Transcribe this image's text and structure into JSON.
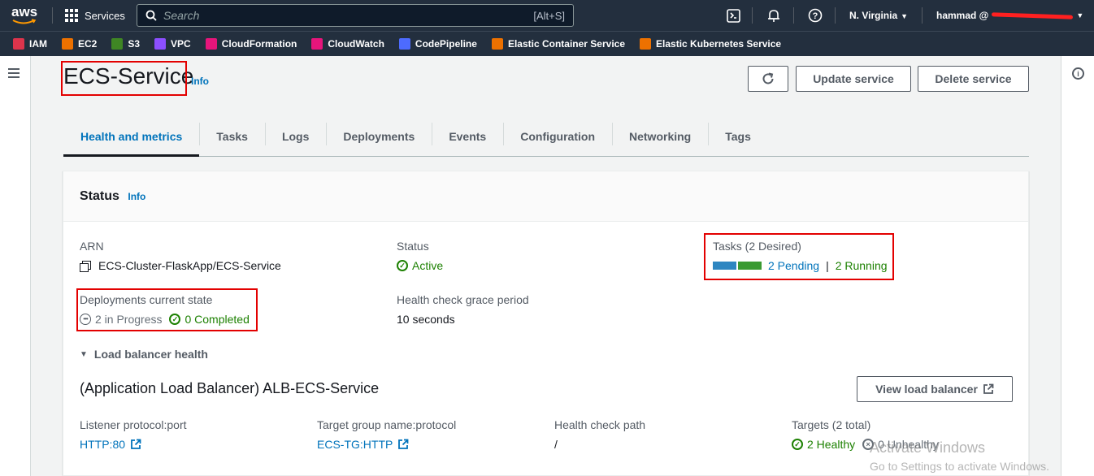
{
  "topnav": {
    "logo": "aws",
    "services_label": "Services",
    "search_placeholder": "Search",
    "search_shortcut": "[Alt+S]",
    "region": "N. Virginia",
    "user": "hammad @"
  },
  "favorites": [
    {
      "label": "IAM",
      "color": "#dd344c",
      "icon": "iam-icon"
    },
    {
      "label": "EC2",
      "color": "#ed7100",
      "icon": "ec2-icon"
    },
    {
      "label": "S3",
      "color": "#3f8624",
      "icon": "s3-icon"
    },
    {
      "label": "VPC",
      "color": "#8c4fff",
      "icon": "vpc-icon"
    },
    {
      "label": "CloudFormation",
      "color": "#e7157b",
      "icon": "cloudformation-icon"
    },
    {
      "label": "CloudWatch",
      "color": "#e7157b",
      "icon": "cloudwatch-icon"
    },
    {
      "label": "CodePipeline",
      "color": "#4d6bfe",
      "icon": "codepipeline-icon"
    },
    {
      "label": "Elastic Container Service",
      "color": "#ed7100",
      "icon": "ecs-icon"
    },
    {
      "label": "Elastic Kubernetes Service",
      "color": "#ed7100",
      "icon": "eks-icon"
    }
  ],
  "header": {
    "title": "ECS-Service",
    "info": "Info",
    "update_button": "Update service",
    "delete_button": "Delete service"
  },
  "tabs": [
    {
      "label": "Health and metrics",
      "active": true
    },
    {
      "label": "Tasks"
    },
    {
      "label": "Logs"
    },
    {
      "label": "Deployments"
    },
    {
      "label": "Events"
    },
    {
      "label": "Configuration"
    },
    {
      "label": "Networking"
    },
    {
      "label": "Tags"
    }
  ],
  "status": {
    "heading": "Status",
    "info": "Info",
    "arn_label": "ARN",
    "arn_value": "ECS-Cluster-FlaskApp/ECS-Service",
    "status_label": "Status",
    "status_value": "Active",
    "tasks_label": "Tasks (2 Desired)",
    "tasks_pending": "2 Pending",
    "tasks_separator": "|",
    "tasks_running": "2 Running",
    "tasks_bar": {
      "pending_fraction": 0.5,
      "running_fraction": 0.5,
      "pending_color": "#2e86c1",
      "running_color": "#3a9a32"
    },
    "deployments_label": "Deployments current state",
    "deployments_in_progress": "2 in Progress",
    "deployments_completed": "0 Completed",
    "grace_label": "Health check grace period",
    "grace_value": "10 seconds"
  },
  "lb": {
    "section_label": "Load balancer health",
    "name": "(Application Load Balancer) ALB-ECS-Service",
    "view_button": "View load balancer",
    "listener_label": "Listener protocol:port",
    "listener_value": "HTTP:80",
    "tg_label": "Target group name:protocol",
    "tg_value": "ECS-TG:HTTP",
    "hc_label": "Health check path",
    "hc_value": "/",
    "targets_label": "Targets (2 total)",
    "targets_healthy": "2 Healthy",
    "targets_unhealthy": "0 Unhealthy"
  },
  "watermark": {
    "line1": "Activate Windows",
    "line2": "Go to Settings to activate Windows."
  },
  "colors": {
    "nav_bg": "#232f3e",
    "link": "#0073bb",
    "success": "#1d8102",
    "highlight_box": "#e30000"
  }
}
